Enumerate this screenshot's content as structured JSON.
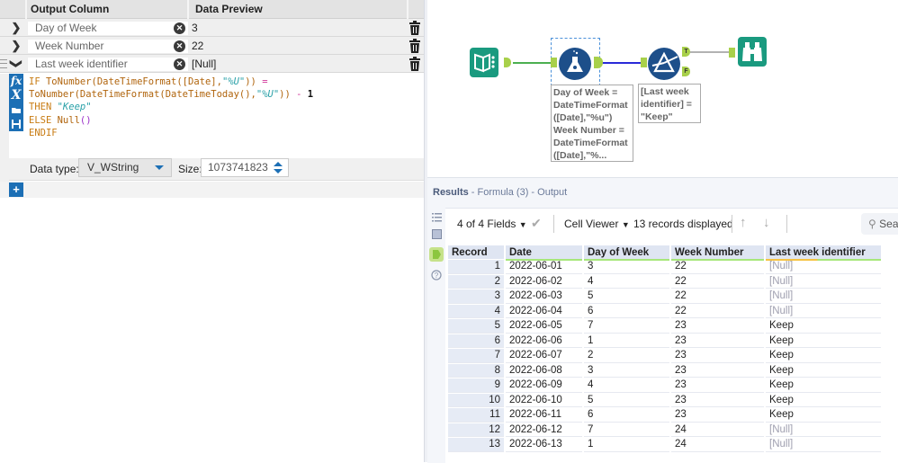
{
  "formula_panel": {
    "headers": {
      "output_column": "Output Column",
      "data_preview": "Data Preview"
    },
    "fields": [
      {
        "name": "Day of Week",
        "preview": "3",
        "expanded": false
      },
      {
        "name": "Week Number",
        "preview": "22",
        "expanded": false
      },
      {
        "name": "Last week identifier",
        "preview": "[Null]",
        "expanded": true
      }
    ],
    "expression_lines": [
      "IF ToNumber(DateTimeFormat([Date],\"%U\")) =",
      "ToNumber(DateTimeFormat(DateTimeToday(),\"%U\")) - 1",
      "THEN \"Keep\"",
      "ELSE Null()",
      "ENDIF"
    ],
    "editor_tools": [
      "fx-icon",
      "variable-icon",
      "open-folder-icon",
      "save-icon"
    ],
    "data_type_label": "Data type:",
    "data_type_value": "V_WString",
    "size_label": "Size:",
    "size_value": "1073741823",
    "add_label": "+"
  },
  "workflow": {
    "tools": [
      {
        "name": "Text Input",
        "icon": "book-icon"
      },
      {
        "name": "Formula",
        "icon": "flask-icon"
      },
      {
        "name": "Filter",
        "icon": "filter-prism-icon"
      },
      {
        "name": "Browse",
        "icon": "binoculars-icon"
      }
    ],
    "formula_annotation": [
      "Day of Week =",
      "DateTimeFormat",
      "([Date],\"%u\")",
      "Week Number =",
      "DateTimeFormat",
      "([Date],\"%..."
    ],
    "filter_annotation": [
      "[Last week",
      "identifier] =",
      "\"Keep\""
    ],
    "filter_true_label": "T",
    "filter_false_label": "F"
  },
  "results": {
    "title_bold": "Results",
    "title_rest": " - Formula (3) - Output",
    "fields_selector": "4 of 4 Fields",
    "cell_viewer": "Cell Viewer",
    "records_displayed": "13 records displayed",
    "search_placeholder": "Sea",
    "columns": [
      "Record",
      "Date",
      "Day of Week",
      "Week Number",
      "Last week identifier"
    ],
    "rows": [
      [
        "1",
        "2022-06-01",
        "3",
        "22",
        "[Null]"
      ],
      [
        "2",
        "2022-06-02",
        "4",
        "22",
        "[Null]"
      ],
      [
        "3",
        "2022-06-03",
        "5",
        "22",
        "[Null]"
      ],
      [
        "4",
        "2022-06-04",
        "6",
        "22",
        "[Null]"
      ],
      [
        "5",
        "2022-06-05",
        "7",
        "23",
        "Keep"
      ],
      [
        "6",
        "2022-06-06",
        "1",
        "23",
        "Keep"
      ],
      [
        "7",
        "2022-06-07",
        "2",
        "23",
        "Keep"
      ],
      [
        "8",
        "2022-06-08",
        "3",
        "23",
        "Keep"
      ],
      [
        "9",
        "2022-06-09",
        "4",
        "23",
        "Keep"
      ],
      [
        "10",
        "2022-06-10",
        "5",
        "23",
        "Keep"
      ],
      [
        "11",
        "2022-06-11",
        "6",
        "23",
        "Keep"
      ],
      [
        "12",
        "2022-06-12",
        "7",
        "24",
        "[Null]"
      ],
      [
        "13",
        "2022-06-13",
        "1",
        "24",
        "[Null]"
      ]
    ]
  },
  "colors": {
    "tool_teal": "#1a9a7f",
    "tool_navy": "#1d4f8a",
    "accent_blue": "#1c6fb5",
    "anchor_green": "#a8d04a",
    "connector_blue": "#2a2ad8",
    "connector_green": "#4caf50"
  }
}
